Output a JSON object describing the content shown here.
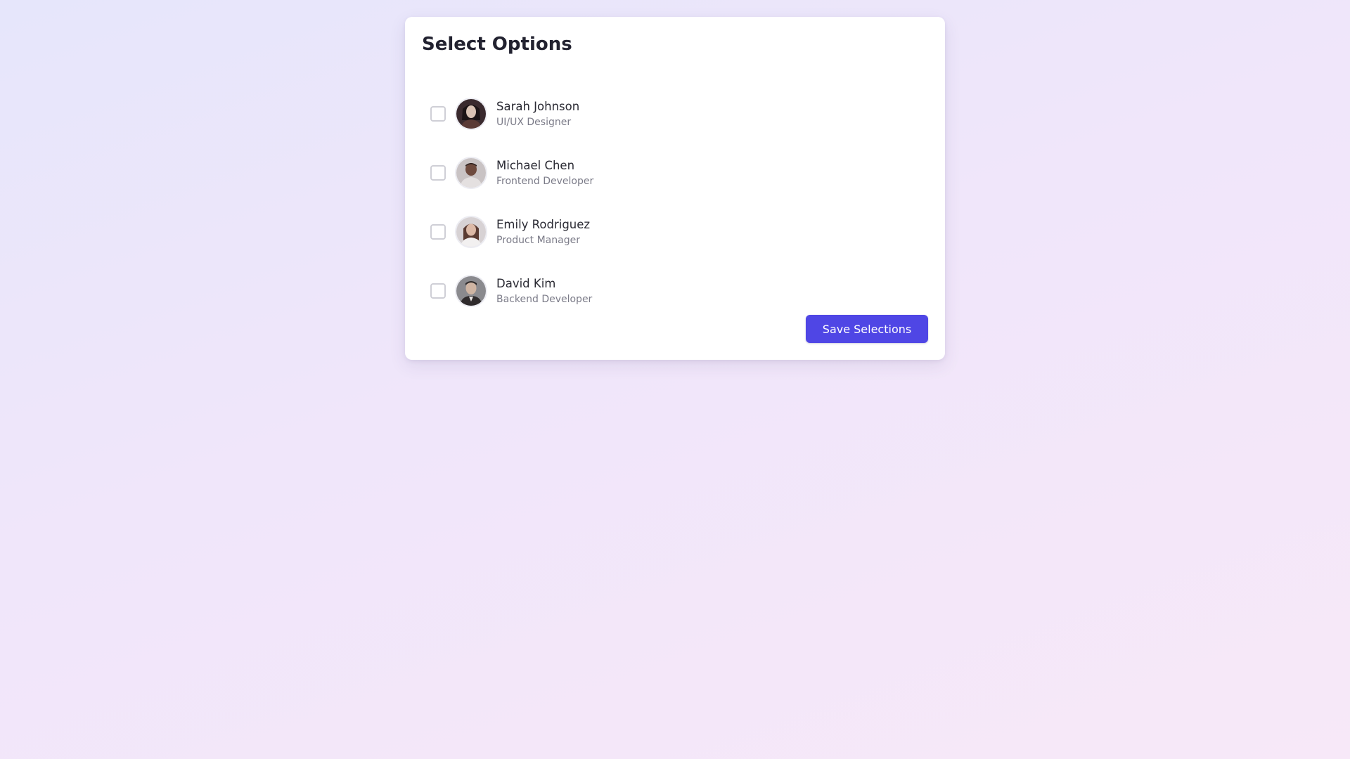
{
  "card": {
    "title": "Select Options",
    "save_label": "Save Selections"
  },
  "options": [
    {
      "name": "Sarah Johnson",
      "role": "UI/UX Designer",
      "checked": false,
      "avatar_icon": "person-photo-icon"
    },
    {
      "name": "Michael Chen",
      "role": "Frontend Developer",
      "checked": false,
      "avatar_icon": "person-photo-icon"
    },
    {
      "name": "Emily Rodriguez",
      "role": "Product Manager",
      "checked": false,
      "avatar_icon": "person-photo-icon"
    },
    {
      "name": "David Kim",
      "role": "Backend Developer",
      "checked": false,
      "avatar_icon": "person-photo-icon"
    }
  ],
  "colors": {
    "accent": "#4f46e5",
    "checkbox_border": "#cfcfd6",
    "name_text": "#2a2a33",
    "role_text": "#7b7b88"
  }
}
